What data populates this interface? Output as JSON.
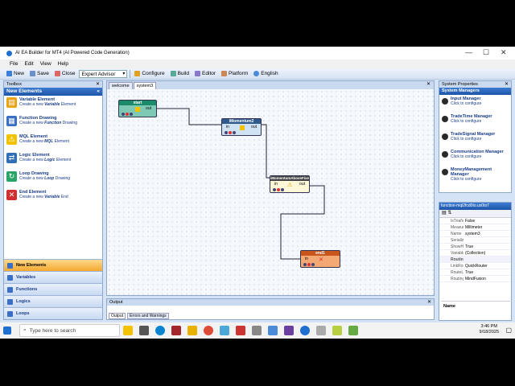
{
  "window": {
    "title": "AI EA Builder for MT4 (AI Powered Code Generation)"
  },
  "menu": [
    "File",
    "Edit",
    "View",
    "Help"
  ],
  "toolbar": {
    "new": "New",
    "save": "Save",
    "close": "Close",
    "mode": "Expert Advisor",
    "configure": "Configure",
    "build": "Build",
    "editor": "Editor",
    "platform": "Platform",
    "language": "English"
  },
  "toolbox": {
    "title": "Toolbox",
    "section": "New Elements",
    "items": [
      {
        "title": "Variable Element",
        "desc_pre": "Create a new ",
        "desc_em": "Variable",
        "desc_post": " Element",
        "color": "#e8a317",
        "glyph": "▤"
      },
      {
        "title": "Function Drawing",
        "desc_pre": "Create a new ",
        "desc_em": "Function",
        "desc_post": " Drawing",
        "color": "#3b6fc4",
        "glyph": "▦"
      },
      {
        "title": "MQL Element",
        "desc_pre": "Create a new ",
        "desc_em": "MQL",
        "desc_post": " Element",
        "color": "#f2c200",
        "glyph": "⚠"
      },
      {
        "title": "Logic Element",
        "desc_pre": "Create a new ",
        "desc_em": "Logic",
        "desc_post": " Element",
        "color": "#2e6fb8",
        "glyph": "⇄"
      },
      {
        "title": "Loop Drawing",
        "desc_pre": "Create a new ",
        "desc_em": "Loop",
        "desc_post": " Drawing",
        "color": "#2aa56a",
        "glyph": "↻"
      },
      {
        "title": "End Element",
        "desc_pre": "Create a new ",
        "desc_em": "Variable",
        "desc_post": " End",
        "color": "#d23030",
        "glyph": "✕"
      }
    ],
    "categories": [
      "New Elements",
      "Variables",
      "Functions",
      "Logics",
      "Loops"
    ]
  },
  "designer": {
    "tabs": [
      "welcome",
      "system3"
    ],
    "nodes": [
      {
        "id": "start",
        "label": "start",
        "out": "out"
      },
      {
        "id": "m2",
        "label": "iMomentum2",
        "in": "in",
        "out": "out"
      },
      {
        "id": "cond",
        "label": "iMomentumAboveFixed",
        "in": "in",
        "out": "out"
      },
      {
        "id": "end",
        "label": "end1",
        "in": "in"
      }
    ]
  },
  "system_properties": {
    "title": "System Properties",
    "section": "System Managers",
    "items": [
      {
        "title": "Input Manager",
        "desc": "Click to configure"
      },
      {
        "title": "TradeTime Manager",
        "desc": "Click to configure"
      },
      {
        "title": "TradeSignal Manager",
        "desc": "Click to configure"
      },
      {
        "title": "Communication Manager",
        "desc": "Click to configure"
      },
      {
        "title": "MoneyManagement Manager",
        "desc": "Click to configure"
      }
    ]
  },
  "function_props": {
    "title": "function-mql2fcd0to.ux0toT",
    "rows": [
      {
        "k": "IsTrialVe",
        "v": "False",
        "group": false
      },
      {
        "k": "Measurer",
        "v": "Millimeter",
        "group": false
      },
      {
        "k": "Name",
        "v": "system3",
        "group": false
      },
      {
        "k": "Serialize",
        "v": "",
        "group": false
      },
      {
        "k": "ShowHo",
        "v": "True",
        "group": false
      },
      {
        "k": "Variable",
        "v": "(Collection)",
        "group": false
      },
      {
        "k": "Routing",
        "v": "",
        "group": true
      },
      {
        "k": "LinkRou",
        "v": "QuickRouter",
        "group": false
      },
      {
        "k": "RouteLir",
        "v": "True",
        "group": false
      },
      {
        "k": "RoutingI",
        "v": "MindFusion",
        "group": false
      }
    ],
    "desc_label": "Name"
  },
  "output": {
    "title": "Output",
    "tabs": [
      "Output",
      "Errors and Warnings"
    ]
  },
  "taskbar": {
    "search_placeholder": "Type here to search",
    "time": "3:46 PM",
    "date": "9/18/2025"
  }
}
